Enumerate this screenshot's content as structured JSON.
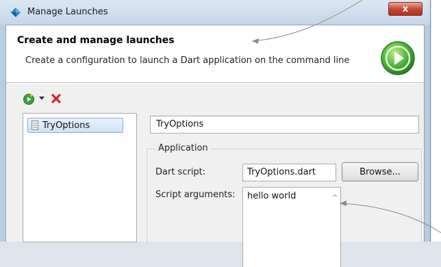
{
  "window": {
    "title": "Manage Launches",
    "close_glyph": "x"
  },
  "banner": {
    "title": "Create and manage launches",
    "description": "Create a configuration to launch a Dart application on the command line"
  },
  "toolbar": {
    "new_icon": "new-launch-icon",
    "dropdown_icon": "chevron-down-icon",
    "delete_icon": "delete-icon"
  },
  "launch_list": {
    "items": [
      {
        "label": "TryOptions",
        "icon": "document-icon",
        "selected": true
      }
    ]
  },
  "config": {
    "name_value": "TryOptions",
    "group_label": "Application",
    "dart_script_label": "Dart script:",
    "dart_script_value": "TryOptions.dart",
    "browse_label": "Browse...",
    "script_args_label": "Script arguments:",
    "script_args_value": "hello world"
  },
  "colors": {
    "accent_green": "#3aa33a",
    "delete_red": "#d2232a",
    "selection_border": "#84acd6",
    "close_red": "#c2422e"
  }
}
